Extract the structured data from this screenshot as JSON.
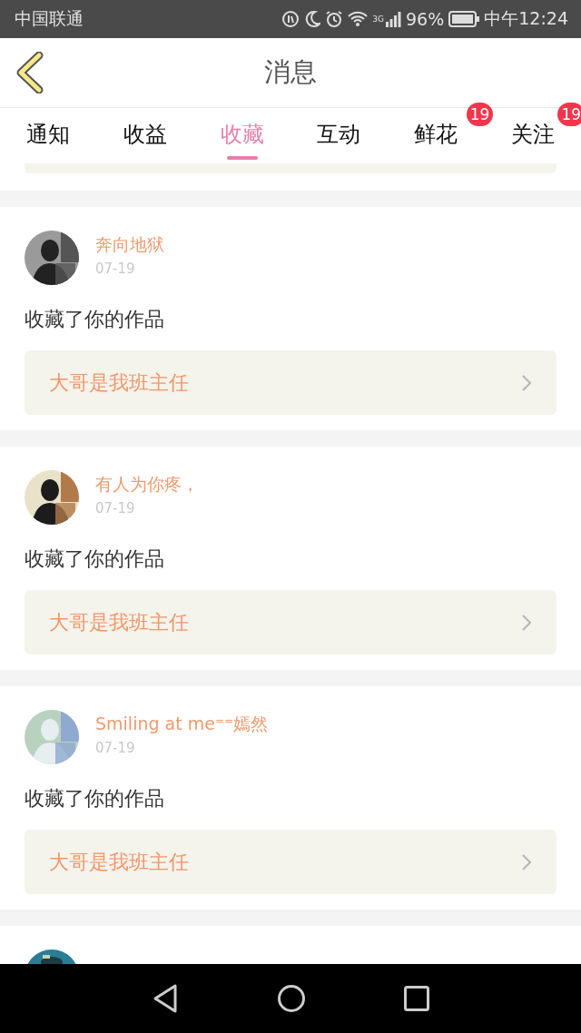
{
  "status_bar": {
    "carrier": "中国联通",
    "network": "3G",
    "battery": "96%",
    "time": "中午12:24"
  },
  "header": {
    "title": "消息"
  },
  "tabs": [
    {
      "label": "通知",
      "selected": false
    },
    {
      "label": "收益",
      "selected": false
    },
    {
      "label": "收藏",
      "selected": true
    },
    {
      "label": "互动",
      "selected": false
    },
    {
      "label": "鲜花",
      "selected": false,
      "badge": "19"
    },
    {
      "label": "关注",
      "selected": false,
      "badge": "19"
    }
  ],
  "messages": [
    {
      "user": "奔向地狱",
      "date": "07-19",
      "action": "收藏了你的作品",
      "work": "大哥是我班主任"
    },
    {
      "user": "有人为你疼，",
      "date": "07-19",
      "action": "收藏了你的作品",
      "work": "大哥是我班主任"
    },
    {
      "user": "Smiling at me⁼⁼嫣然",
      "date": "07-19",
      "action": "收藏了你的作品",
      "work": "大哥是我班主任"
    }
  ]
}
